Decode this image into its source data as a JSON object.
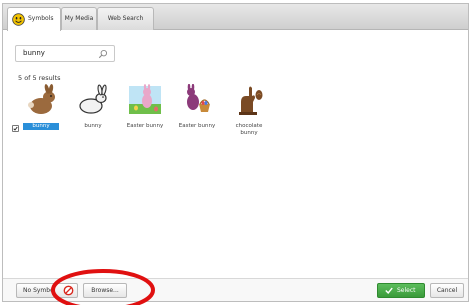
{
  "tabs": [
    {
      "label": "Symbols",
      "icon": "smiley-face-icon",
      "active": true
    },
    {
      "label": "My Media",
      "active": false
    },
    {
      "label": "Web Search",
      "active": false
    }
  ],
  "search": {
    "value": "bunny",
    "icon": "magnifier-icon"
  },
  "results": {
    "count_text": "5 of 5 results",
    "items": [
      {
        "label": "bunny",
        "selected": true
      },
      {
        "label": "bunny",
        "selected": false
      },
      {
        "label": "Easter bunny",
        "selected": false
      },
      {
        "label": "Easter bunny",
        "selected": false
      },
      {
        "label": "chocolate bunny",
        "selected": false
      }
    ]
  },
  "footer": {
    "no_symbol_label": "No Symbol",
    "browse_label": "Browse...",
    "select_label": "Select",
    "cancel_label": "Cancel"
  },
  "colors": {
    "accent": "#2a8fd9",
    "select_button": "#4aaa4a",
    "annotation": "#e01010"
  }
}
